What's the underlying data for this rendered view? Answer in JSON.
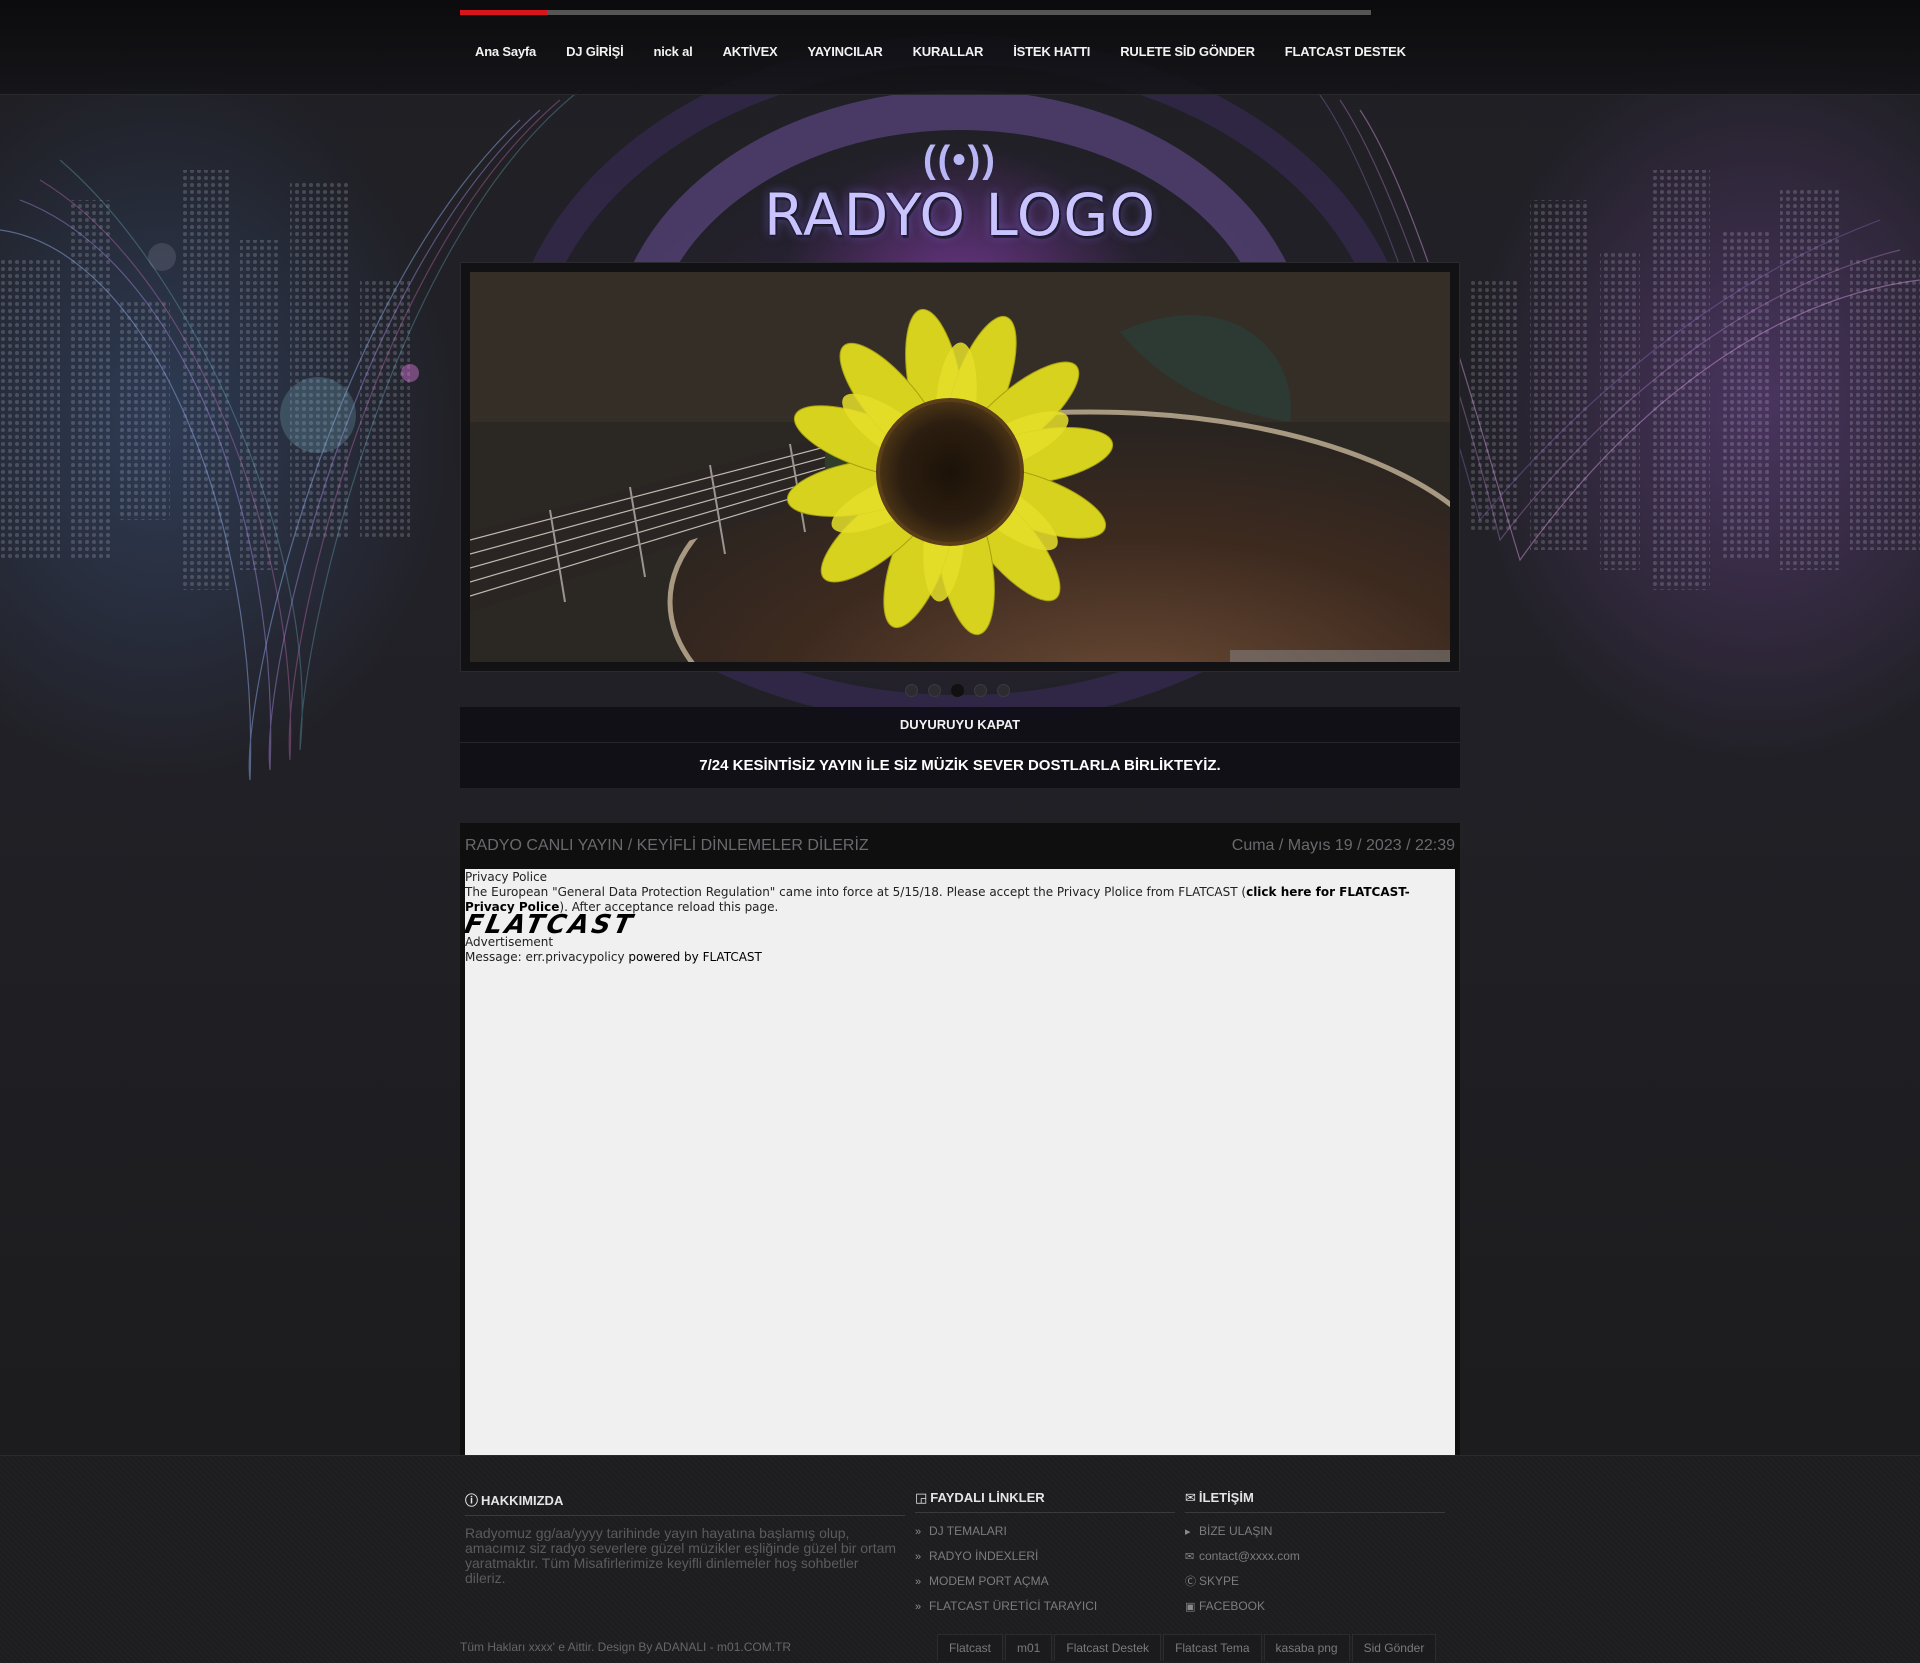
{
  "nav": {
    "progress": 0.096,
    "items": [
      {
        "label": "Ana Sayfa"
      },
      {
        "label": "DJ GİRİŞİ"
      },
      {
        "label": "nick al"
      },
      {
        "label": "AKTİVEX"
      },
      {
        "label": "YAYINCILAR"
      },
      {
        "label": "KURALLAR"
      },
      {
        "label": "İSTEK HATTI"
      },
      {
        "label": "RULETE SİD GÖNDER"
      },
      {
        "label": "FLATCAST DESTEK"
      }
    ]
  },
  "logo": {
    "waves": "((•))",
    "text": "RADYO LOGO"
  },
  "slider": {
    "image": "sunflower-on-guitar",
    "dots": 5,
    "active_dot": 3
  },
  "announcement": {
    "close_label": "DUYURUYU KAPAT",
    "message": "7/24 KESİNTİSİZ YAYIN İLE SİZ MÜZİK SEVER DOSTLARLA BİRLİKTEYİZ."
  },
  "content": {
    "title": "RADYO CANLI YAYIN / KEYİFLİ DİNLEMELER DİLERİZ",
    "date": "Cuma / Mayıs 19 / 2023 / 22:39",
    "frame": {
      "heading": "Privacy Police",
      "notice_pre": "The European \"General Data Protection Regulation\" came into force at 5/15/18. Please accept the Privacy Plolice from FLATCAST (",
      "notice_link": "click here for FLATCAST-Privacy Police",
      "notice_post": "). After acceptance reload this page.",
      "logo_text": "FLATCAST",
      "ad_label": "Advertisement",
      "message_pre": "Message: err.privacypolicy",
      "message_post": " powered by FLATCAST"
    }
  },
  "footer": {
    "about": {
      "heading": "HAKKIMIZDA",
      "text": "Radyomuz gg/aa/yyyy tarihinde yayın hayatına başlamış olup, amacımız siz radyo severlere güzel müzikler eşliğinde güzel bir ortam yaratmaktır. Tüm Misafirlerimize keyifli dinlemeler hoş sohbetler dileriz."
    },
    "links": {
      "heading": "FAYDALI LİNKLER",
      "items": [
        {
          "label": "DJ TEMALARI"
        },
        {
          "label": "RADYO İNDEXLERİ"
        },
        {
          "label": "MODEM PORT AÇMA"
        },
        {
          "label": "FLATCAST ÜRETİCİ TARAYICI"
        }
      ]
    },
    "contact": {
      "heading": "İLETİŞİM",
      "items": [
        {
          "icon": "caret-icon",
          "label": "BİZE ULAŞIN"
        },
        {
          "icon": "envelope-icon",
          "label": "contact@xxxx.com"
        },
        {
          "icon": "skype-icon",
          "label": "SKYPE"
        },
        {
          "icon": "facebook-icon",
          "label": "FACEBOOK"
        }
      ]
    },
    "copyright": "Tüm Hakları xxxx' e Aittir. Design By ADANALI - m01.COM.TR",
    "bottom_links": [
      {
        "label": "Flatcast"
      },
      {
        "label": "m01"
      },
      {
        "label": "Flatcast Destek"
      },
      {
        "label": "Flatcast Tema"
      },
      {
        "label": "kasaba png"
      },
      {
        "label": "Sid Gönder"
      }
    ]
  },
  "colors": {
    "accent_red": "#d8151b",
    "logo_lavender": "#c9c4ff",
    "page_bg": "#1a1a1b"
  }
}
